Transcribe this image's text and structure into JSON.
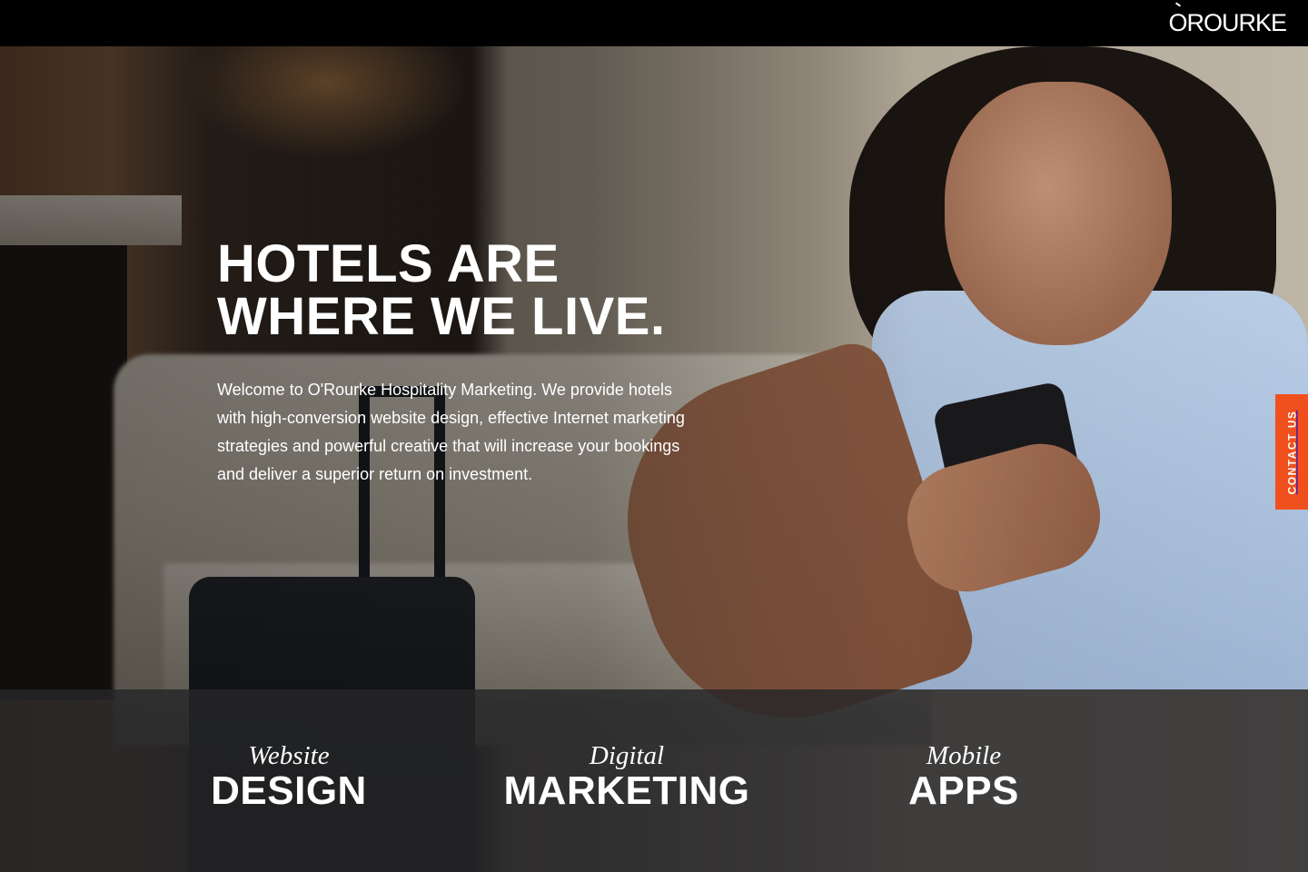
{
  "header": {
    "logo_text": "O'ROURKE",
    "logo_display": "OROURKE"
  },
  "hero": {
    "title_line1": "HOTELS ARE",
    "title_line2": "WHERE WE LIVE.",
    "body": "Welcome to O'Rourke Hospitality Marketing. We provide hotels with high-conversion website design, effective Internet marketing strategies and powerful creative that will increase your bookings and deliver a superior return on investment.",
    "image_description_icon": "hero-photo"
  },
  "contact_tab": {
    "label": "CONTACT US",
    "color": "#f0501e"
  },
  "services": [
    {
      "top": "Website",
      "main": "DESIGN"
    },
    {
      "top": "Digital",
      "main": "MARKETING"
    },
    {
      "top": "Mobile",
      "main": "APPS"
    }
  ],
  "colors": {
    "topbar": "#000000",
    "accent": "#f0501e",
    "services_bar": "#262628"
  }
}
